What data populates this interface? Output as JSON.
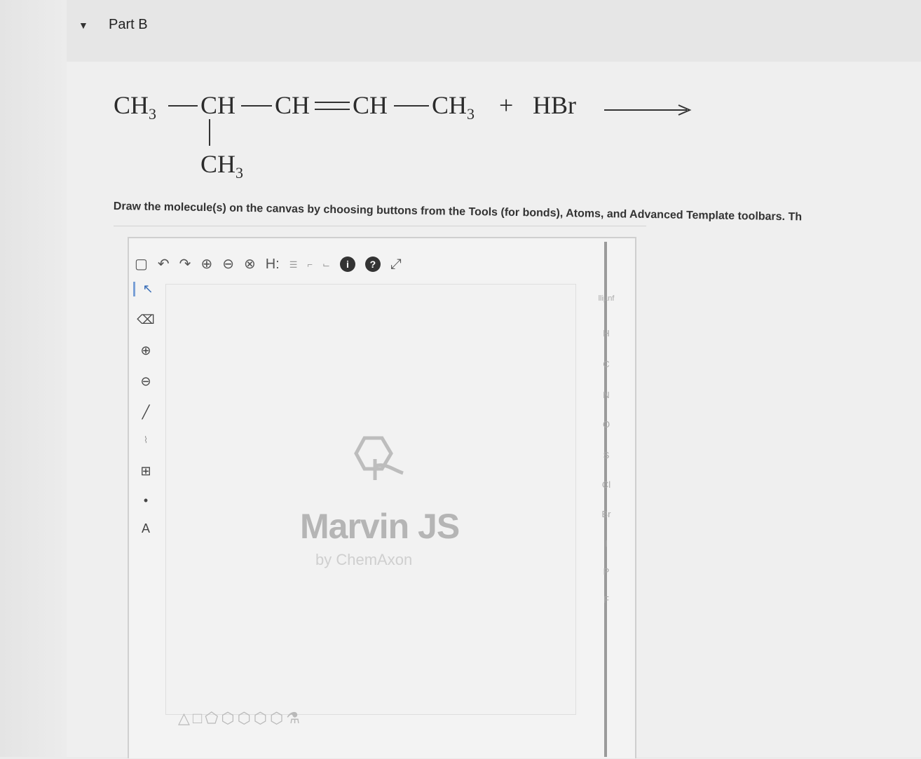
{
  "part": {
    "toggle_icon": "▼",
    "title": "Part B"
  },
  "reaction": {
    "c1": "CH",
    "c1_sub": "3",
    "c2": "CH",
    "c3": "CH",
    "c4": "CH",
    "c5": "CH",
    "c5_sub": "3",
    "branch": "CH",
    "branch_sub": "3",
    "plus": "+",
    "reagent": "HBr"
  },
  "instructions": "Draw the molecule(s) on the canvas by choosing buttons from the Tools (for bonds), Atoms, and Advanced Template toolbars. Th",
  "editor": {
    "logo_title": "Marvin JS",
    "logo_sub": "by ChemAxon",
    "top_toolbar": [
      "new-doc-icon",
      "undo-icon",
      "redo-icon",
      "zoom-in-icon",
      "zoom-out-icon",
      "zoom-fit-icon",
      "h-toggle-icon",
      "abbrev-icon",
      "cip-icon",
      "stereo-icon",
      "info-icon",
      "help-icon",
      "fullscreen-icon"
    ],
    "top_h_label": "H:",
    "left_toolbar": [
      "select-icon",
      "eraser-icon",
      "charge-plus-icon",
      "charge-minus-icon",
      "bond-icon",
      "chain-icon",
      "template-icon",
      "radical-icon",
      "text-icon"
    ],
    "text_tool_label": "A",
    "atoms": [
      "H",
      "C",
      "N",
      "O",
      "S",
      "Cl",
      "Br",
      "I",
      "P",
      "F"
    ],
    "periodic_label": "lliµnf",
    "bottom_templates": [
      "△",
      "□",
      "⬠",
      "⬡",
      "⬡",
      "⬡",
      "⬡",
      "⚗"
    ]
  }
}
